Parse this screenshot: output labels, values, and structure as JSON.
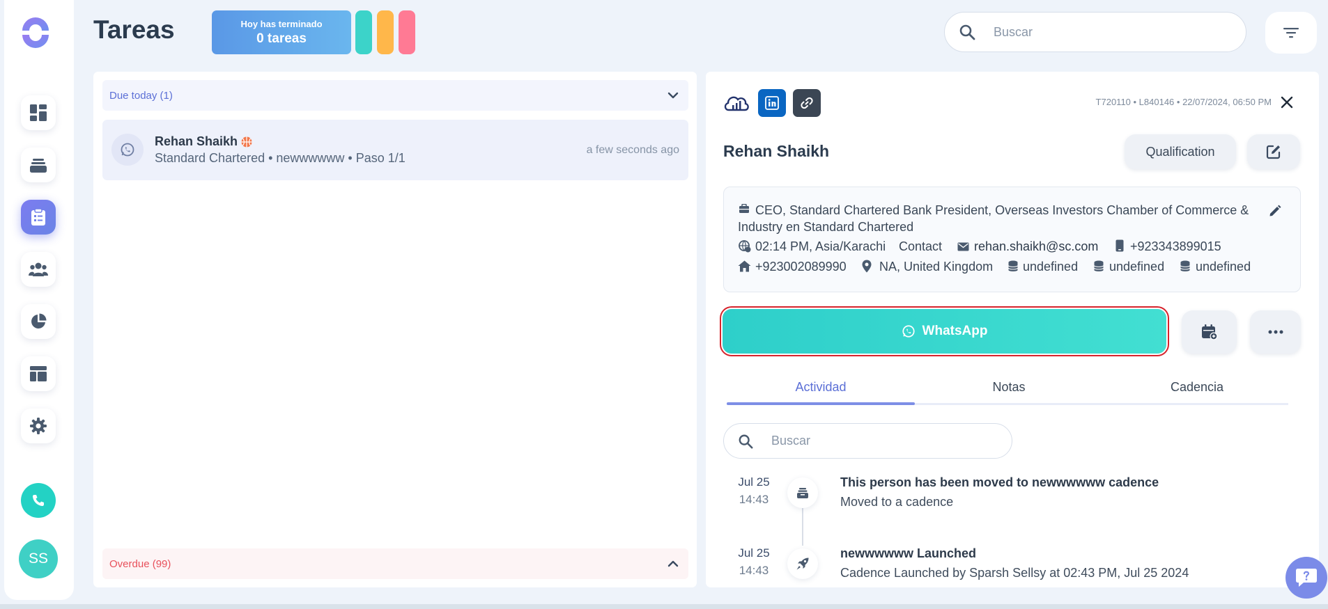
{
  "header": {
    "title": "Tareas",
    "finished_line1": "Hoy has terminado",
    "finished_line2": "0 tareas",
    "search_placeholder": "Buscar",
    "pill_colors": [
      "#3cd3c9",
      "#ffb74a",
      "#ff7a94"
    ]
  },
  "sidebar": {
    "items": [
      {
        "icon": "dashboard-icon"
      },
      {
        "icon": "inbox-stack-icon"
      },
      {
        "icon": "clipboard-tasks-icon",
        "active": true
      },
      {
        "icon": "users-icon"
      },
      {
        "icon": "pie-chart-icon"
      },
      {
        "icon": "layout-icon"
      },
      {
        "icon": "gear-icon"
      }
    ],
    "avatar_initials": "SS"
  },
  "task_list": {
    "due_today_label": "Due today (1)",
    "overdue_label": "Overdue (99)",
    "tasks": [
      {
        "name": "Rehan Shaikh",
        "subtitle": "Standard Chartered • newwwwww • Paso 1/1",
        "time": "a few seconds ago"
      }
    ]
  },
  "detail": {
    "meta": "T720110 • L840146 • 22/07/2024, 06:50 PM",
    "name": "Rehan Shaikh",
    "qualification_label": "Qualification",
    "job_title": "CEO, Standard Chartered Bank President, Overseas Investors Chamber of Commerce & Industry en Standard Chartered",
    "local_time": "02:14 PM, Asia/Karachi",
    "contact_label": "Contact",
    "email": "rehan.shaikh@sc.com",
    "mobile": "+923343899015",
    "phone": "+923002089990",
    "location": "NA, United Kingdom",
    "extra_fields": [
      "undefined",
      "undefined",
      "undefined"
    ],
    "whatsapp_label": "WhatsApp",
    "tabs": [
      "Actividad",
      "Notas",
      "Cadencia"
    ],
    "active_tab": "Actividad",
    "activity_search_placeholder": "Buscar",
    "events": [
      {
        "date": "Jul 25",
        "time": "14:43",
        "title": "This person has been moved to newwwwww cadence",
        "subtitle": "Moved to a cadence",
        "icon": "cadence-inbox-icon"
      },
      {
        "date": "Jul 25",
        "time": "14:43",
        "title": "newwwwww Launched",
        "subtitle": "Cadence Launched by Sparsh Sellsy at 02:43 PM, Jul 25 2024",
        "icon": "rocket-icon"
      }
    ]
  },
  "colors": {
    "accent": "#7b8be8",
    "whatsapp": "#36d6cc",
    "overdue": "#e8505b",
    "due_today": "#5b6fd6"
  }
}
